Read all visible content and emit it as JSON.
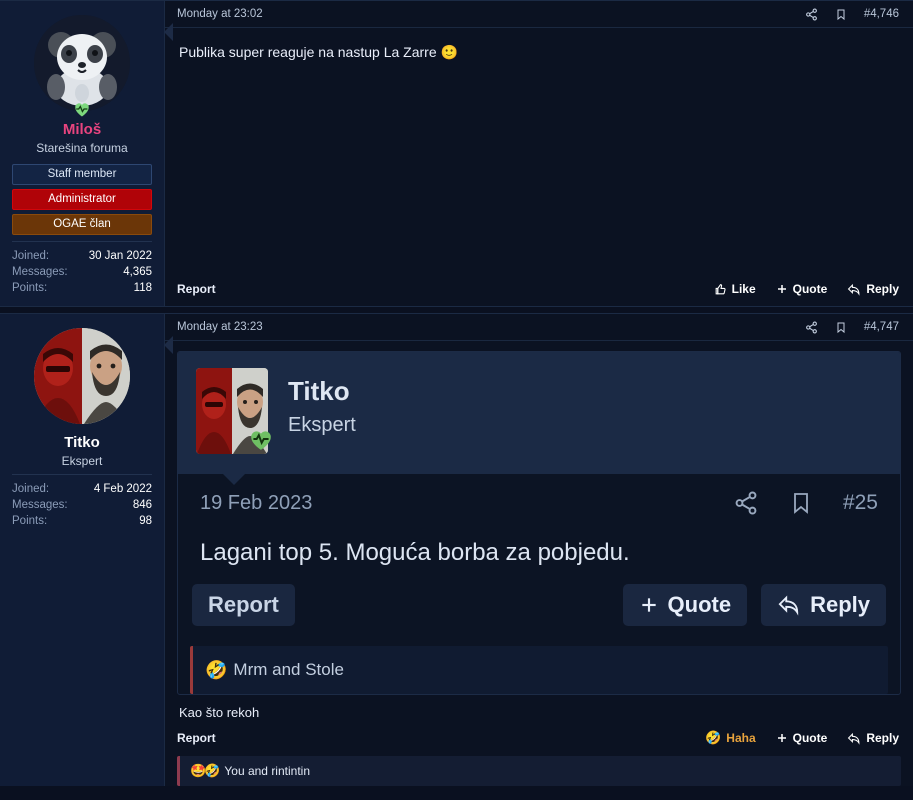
{
  "theme": {
    "page_bg": "#0a1020",
    "post_bg": "#0b1222",
    "usercard_bg": "#101c36",
    "accent_admin": "#e8447f",
    "badge_admin_bg": "#b00308",
    "badge_ogae_bg": "#6b3608",
    "reaction_accent": "#9a3a3a",
    "haha_color": "#e8a33d"
  },
  "posts": [
    {
      "user": {
        "name": "Miloš",
        "title": "Stareลกina foruma",
        "title_text": "Starešina foruma",
        "avatar_icon": "panda-avatar",
        "badge_icon": "green-heart-pulse-icon",
        "badges": [
          {
            "label": "Staff member",
            "style": "staff"
          },
          {
            "label": "Administrator",
            "style": "admin"
          },
          {
            "label": "OGAE član",
            "style": "ogae"
          }
        ],
        "stats": [
          {
            "label": "Joined:",
            "value": "30 Jan 2022"
          },
          {
            "label": "Messages:",
            "value": "4,365"
          },
          {
            "label": "Points:",
            "value": "118"
          }
        ]
      },
      "date": "Monday at 23:02",
      "post_number": "#4,746",
      "text": "Publika super reaguje na nastup La Zarre ",
      "text_emoji": "🙂",
      "report_label": "Report",
      "actions": [
        {
          "label": "Like",
          "icon": "thumbs-up-icon"
        },
        {
          "label": "Quote",
          "icon": "plus-icon"
        },
        {
          "label": "Reply",
          "icon": "reply-arrow-icon"
        }
      ]
    },
    {
      "user": {
        "name": "Titko",
        "title_text": "Ekspert",
        "avatar_icon": "split-face-avatar",
        "stats": [
          {
            "label": "Joined:",
            "value": "4 Feb 2022"
          },
          {
            "label": "Messages:",
            "value": "846"
          },
          {
            "label": "Points:",
            "value": "98"
          }
        ]
      },
      "date": "Monday at 23:23",
      "post_number": "#4,747",
      "quoted": {
        "name": "Titko",
        "title": "Ekspert",
        "avatar_icon": "split-face-avatar",
        "badge_icon": "green-heart-pulse-icon",
        "date": "19 Feb 2023",
        "post_number": "#25",
        "text": "Lagani top 5. Moguća borba za pobjedu.",
        "report_label": "Report",
        "quote_label": "Quote",
        "reply_label": "Reply"
      },
      "quote_reactions": {
        "emoji": "🤣",
        "text": "Mrm and Stole"
      },
      "text": "Kao što rekoh",
      "report_label": "Report",
      "actions": [
        {
          "label": "Haha",
          "icon": "rofl-emoji"
        },
        {
          "label": "Quote",
          "icon": "plus-icon"
        },
        {
          "label": "Reply",
          "icon": "reply-arrow-icon"
        }
      ],
      "reactions": {
        "emoji": "🤩🤣",
        "text": "You and rintintin"
      }
    }
  ]
}
